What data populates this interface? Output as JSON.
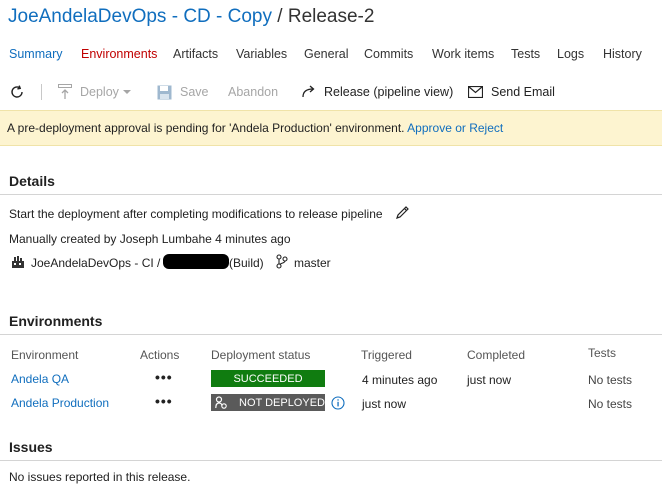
{
  "header": {
    "pipeline_link": "JoeAndelaDevOps - CD - Copy",
    "separator": "/",
    "release_name": "Release-2"
  },
  "tabs": [
    {
      "label": "Summary",
      "state": "active"
    },
    {
      "label": "Environments",
      "state": "highlight"
    },
    {
      "label": "Artifacts"
    },
    {
      "label": "Variables"
    },
    {
      "label": "General"
    },
    {
      "label": "Commits"
    },
    {
      "label": "Work items"
    },
    {
      "label": "Tests"
    },
    {
      "label": "Logs"
    },
    {
      "label": "History"
    }
  ],
  "toolbar": {
    "refresh_icon": "refresh-icon",
    "deploy_label": "Deploy",
    "save_label": "Save",
    "abandon_label": "Abandon",
    "pipeline_view_label": "Release (pipeline view)",
    "send_email_label": "Send Email"
  },
  "banner": {
    "message": "A pre-deployment approval is pending for 'Andela Production' environment.",
    "action_label": "Approve or Reject"
  },
  "details": {
    "heading": "Details",
    "description": "Start the deployment after completing modifications to release pipeline",
    "created": "Manually created by Joseph Lumbahe 4 minutes ago",
    "artifact_prefix": "JoeAndelaDevOps - CI / 2",
    "artifact_suffix": "(Build)",
    "branch": "master"
  },
  "environments": {
    "heading": "Environments",
    "columns": [
      "Environment",
      "Actions",
      "Deployment status",
      "Triggered",
      "Completed",
      "Tests"
    ],
    "rows": [
      {
        "name": "Andela QA",
        "actions": "•••",
        "status": "SUCCEEDED",
        "triggered": "4 minutes ago",
        "completed": "just now",
        "tests": "No tests"
      },
      {
        "name": "Andela Production",
        "actions": "•••",
        "status": "NOT DEPLOYED",
        "triggered": "just now",
        "completed": "",
        "tests": "No tests"
      }
    ]
  },
  "issues": {
    "heading": "Issues",
    "message": "No issues reported in this release."
  },
  "colors": {
    "accent": "#106ebe",
    "succeeded": "#107c10",
    "not_deployed": "#5a5a5a",
    "banner_bg": "#fdf4d0",
    "environments_tab": "#c00000"
  }
}
